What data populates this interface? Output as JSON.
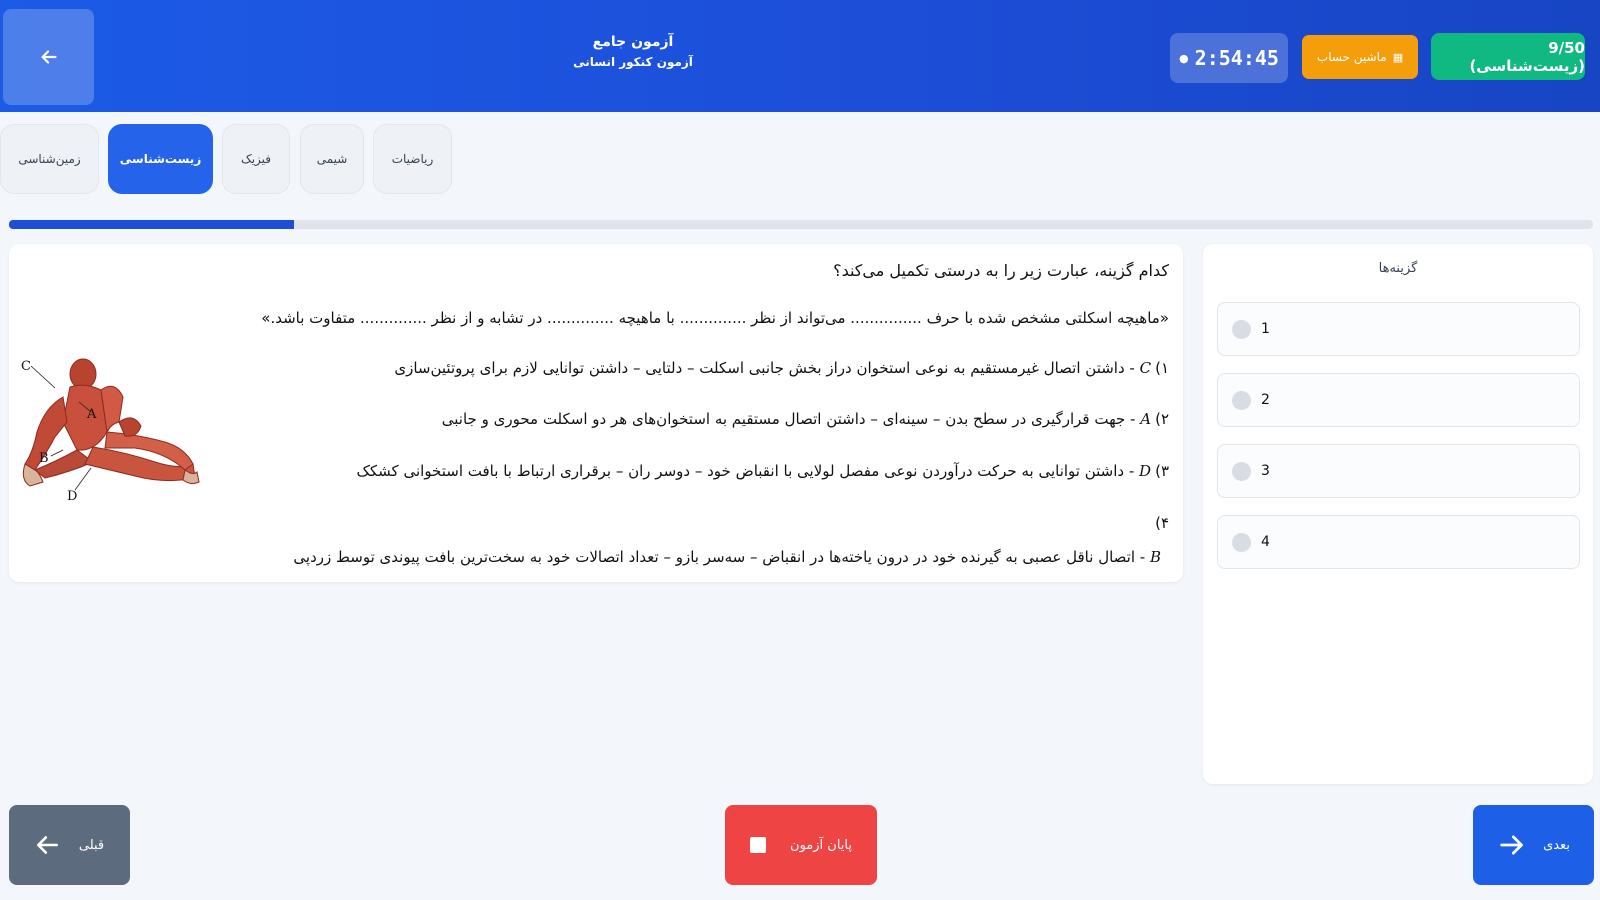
{
  "header": {
    "title": "آزمون جامع",
    "subtitle": "آزمون کنکور انسانی",
    "timer": "2:54:45",
    "calculator_label": "ماشین حساب",
    "score_badge": "9/50 (زیست‌شناسی)"
  },
  "tabs": [
    {
      "label": "ریاضیات",
      "active": false
    },
    {
      "label": "شیمی",
      "active": false
    },
    {
      "label": "فیزیک",
      "active": false
    },
    {
      "label": "زیست‌شناسی",
      "active": true
    },
    {
      "label": "زمین‌شناسی",
      "active": false
    }
  ],
  "progress": {
    "fraction": 0.18
  },
  "question": {
    "prompt": "کدام گزینه، عبارت زیر را به درستی تکمیل می‌کند؟",
    "statement": "«ماهیچه اسکلتی مشخص شده با حرف ............... می‌تواند از نظر .............. با ماهیچه .............. در تشابه و از نظر .............. متفاوت باشد.»",
    "choices": [
      {
        "num": "۱)",
        "letter": "C",
        "text": " - داشتن اتصال غیرمستقیم به نوعی استخوان دراز بخش جانبی اسکلت – دلتایی – داشتن توانایی لازم برای پروتئین‌سازی"
      },
      {
        "num": "۲)",
        "letter": "A",
        "text": " - جهت قرارگیری در سطح بدن – سینه‌ای – داشتن اتصال مستقیم به استخوان‌های هر دو اسکلت محوری و جانبی"
      },
      {
        "num": "۳)",
        "letter": "D",
        "text": " - داشتن توانایی به حرکت درآوردن نوعی مفصل لولایی با انقباض خود – دوسر ران – برقراری ارتباط با بافت استخوانی کشکک"
      },
      {
        "num": "۴)",
        "letter": "B",
        "text": " - اتصال ناقل عصبی به گیرنده خود در درون یاخته‌ها در انقباض – سه‌سر بازو – تعداد اتصالات خود به سخت‌ترین بافت پیوندی توسط زردپی"
      }
    ],
    "figure_labels": [
      "C",
      "A",
      "B",
      "D"
    ]
  },
  "options": {
    "title": "گزینه‌ها",
    "items": [
      "1",
      "2",
      "3",
      "4"
    ]
  },
  "footer": {
    "prev_label": "قبلی",
    "end_label": "پایان آزمون",
    "next_label": "بعدی"
  },
  "colors": {
    "header": "#1d4ed8",
    "accent": "#2563eb",
    "timer_bg": "#3f6fe0",
    "calculator": "#f59e0b",
    "score": "#10b981",
    "danger": "#ef4444",
    "prev": "#5d6b7e"
  }
}
